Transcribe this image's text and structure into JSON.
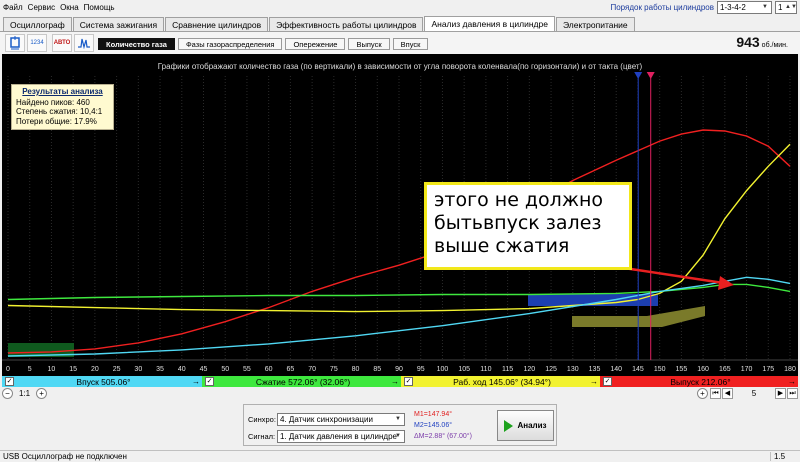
{
  "menu": [
    "Файл",
    "Сервис",
    "Окна",
    "Помощь"
  ],
  "cylinder_order": {
    "label": "Порядок работы цилиндров",
    "value": "1-3-4-2",
    "spin": "1"
  },
  "tabs": [
    {
      "label": "Осциллограф",
      "active": false
    },
    {
      "label": "Система зажигания",
      "active": false
    },
    {
      "label": "Сравнение цилиндров",
      "active": false
    },
    {
      "label": "Эффективность работы цилиндров",
      "active": false
    },
    {
      "label": "Анализ давления в цилиндре",
      "active": true
    },
    {
      "label": "Электропитание",
      "active": false
    }
  ],
  "toolbar_icons": [
    {
      "name": "cylinder-icon",
      "caption": ""
    },
    {
      "name": "cylinder-numbers-icon",
      "caption": "1234"
    },
    {
      "name": "auto-icon",
      "caption": "АВТО"
    },
    {
      "name": "pulse-icon",
      "caption": ""
    }
  ],
  "subtabs": [
    {
      "label": "Количество газа",
      "active": true
    },
    {
      "label": "Фазы газораспределения",
      "active": false
    },
    {
      "label": "Опережение",
      "active": false
    },
    {
      "label": "Выпуск",
      "active": false
    },
    {
      "label": "Впуск",
      "active": false
    }
  ],
  "rpm": {
    "value": "943",
    "unit": "об./мин."
  },
  "chart_caption": "Графики отображают количество газа (по вертикали) в зависимости от угла поворота коленвала(по горизонтали) и от такта (цвет)",
  "results": {
    "title": "Результаты анализа",
    "peaks": "Найдено пиков: 460",
    "compression": "Степень сжатия: 10,4:1",
    "losses": "Потери общие: 17.9%"
  },
  "annotation": "этого не должно быть впуск залез выше сжатия",
  "annotation_lines": [
    "этого не должно",
    "бытьвпуск залез",
    "выше сжатия"
  ],
  "strokes": [
    {
      "label": "Впуск 505.06°",
      "color": "#50d8f4"
    },
    {
      "label": "Сжатие 572.06° (32.06°)",
      "color": "#3ee83e"
    },
    {
      "label": "Раб. ход 145.06° (34.94°)",
      "color": "#f2f230"
    },
    {
      "label": "Выпуск 212.06°",
      "color": "#f02020"
    }
  ],
  "nav": {
    "scale": "1:1",
    "page": "5"
  },
  "sync": {
    "label": "Синхро:",
    "value": "4. Датчик синхронизации"
  },
  "signal": {
    "label": "Сигнал:",
    "value": "1. Датчик давления в цилиндре"
  },
  "markers": {
    "m1": "M1=147.94°",
    "m2": "M2=145.06°",
    "dm": "ΔM=2.88° (67.00°)"
  },
  "analyze_label": "Анализ",
  "status": {
    "text": "USB Осциллограф не подключен",
    "version": "1.5"
  },
  "colors": {
    "intake": "#50d8f4",
    "compression": "#3ee83e",
    "power": "#f2f230",
    "exhaust": "#f02020",
    "marker1": "#2040c0",
    "marker2": "#e02060",
    "bg": "#000000"
  },
  "chart_data": {
    "type": "line",
    "xlabel": "",
    "ylabel": "",
    "xlim": [
      0,
      180
    ],
    "x_ticks": [
      0,
      5,
      10,
      15,
      20,
      25,
      30,
      35,
      40,
      45,
      50,
      55,
      60,
      65,
      70,
      75,
      80,
      85,
      90,
      95,
      100,
      105,
      110,
      115,
      120,
      125,
      130,
      135,
      140,
      145,
      150,
      155,
      160,
      165,
      170,
      175,
      180
    ],
    "series": [
      {
        "color": "#f02020",
        "x": [
          0,
          10,
          20,
          30,
          40,
          50,
          60,
          70,
          80,
          90,
          100,
          110,
          120,
          130,
          140,
          150,
          155,
          160,
          165,
          170,
          175,
          180
        ],
        "y": [
          5,
          6,
          9,
          15,
          24,
          36,
          50,
          66,
          80,
          92,
          106,
          124,
          152,
          176,
          196,
          215,
          222,
          226,
          225,
          220,
          210,
          190
        ]
      },
      {
        "color": "#f2f230",
        "x": [
          0,
          20,
          40,
          60,
          80,
          100,
          120,
          130,
          140,
          145,
          150,
          155,
          160,
          165,
          170,
          175,
          180
        ],
        "y": [
          52,
          50,
          48,
          47,
          46,
          47,
          49,
          52,
          55,
          58,
          64,
          76,
          102,
          138,
          166,
          190,
          212
        ]
      },
      {
        "color": "#3ee83e",
        "x": [
          0,
          20,
          40,
          60,
          80,
          100,
          120,
          140,
          150,
          160,
          165,
          170,
          175,
          180
        ],
        "y": [
          58,
          60,
          61,
          62,
          62,
          63,
          63,
          64,
          66,
          70,
          73,
          73,
          70,
          66
        ]
      },
      {
        "color": "#50d8f4",
        "x": [
          0,
          20,
          40,
          60,
          80,
          100,
          120,
          140,
          150,
          160,
          165,
          170,
          175,
          180
        ],
        "y": [
          2,
          4,
          8,
          14,
          22,
          32,
          44,
          58,
          66,
          72,
          76,
          80,
          78,
          74
        ]
      }
    ],
    "markers": [
      145.06,
      147.94
    ]
  }
}
